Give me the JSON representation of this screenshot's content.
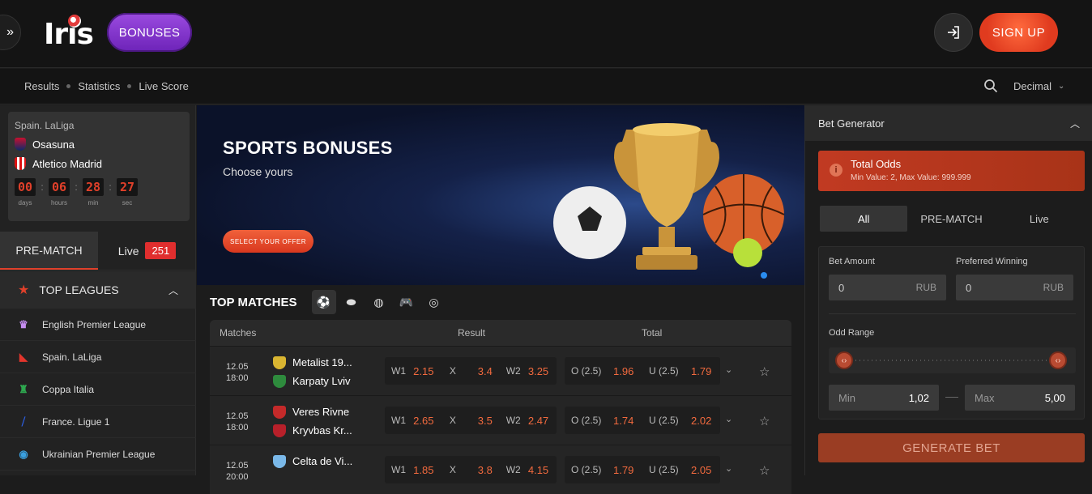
{
  "header": {
    "logo_text": "Iris",
    "bonuses_label": "BONUSES",
    "signup_label": "SIGN UP"
  },
  "subnav": {
    "links": [
      "Results",
      "Statistics",
      "Live Score"
    ],
    "odds_format": "Decimal"
  },
  "live_card": {
    "league": "Spain. LaLiga",
    "team1": "Osasuna",
    "team2": "Atletico Madrid",
    "countdown": [
      {
        "value": "00",
        "label": "days"
      },
      {
        "value": "06",
        "label": "hours"
      },
      {
        "value": "28",
        "label": "min"
      },
      {
        "value": "27",
        "label": "sec"
      }
    ]
  },
  "mode_tabs": {
    "prematch": "PRE-MATCH",
    "live": "Live",
    "live_count": "251"
  },
  "top_leagues": {
    "title": "TOP LEAGUES",
    "items": [
      "English Premier League",
      "Spain. LaLiga",
      "Coppa Italia",
      "France. Ligue 1",
      "Ukrainian Premier League"
    ]
  },
  "banner": {
    "title": "SPORTS BONUSES",
    "subtitle": "Choose yours",
    "button": "SELECT YOUR OFFER"
  },
  "top_matches": {
    "title": "TOP MATCHES",
    "columns": {
      "matches": "Matches",
      "result": "Result",
      "total": "Total"
    },
    "rows": [
      {
        "date": "12.05",
        "time": "18:00",
        "team1": "Metalist 19...",
        "team2": "Karpaty Lviv",
        "w1": "2.15",
        "x": "3.4",
        "w2": "3.25",
        "o_label": "O (2.5)",
        "o": "1.96",
        "u_label": "U (2.5)",
        "u": "1.79",
        "lbl_w1": "W1",
        "lbl_x": "X",
        "lbl_w2": "W2"
      },
      {
        "date": "12.05",
        "time": "18:00",
        "team1": "Veres Rivne",
        "team2": "Kryvbas Kr...",
        "w1": "2.65",
        "x": "3.5",
        "w2": "2.47",
        "o_label": "O (2.5)",
        "o": "1.74",
        "u_label": "U (2.5)",
        "u": "2.02",
        "lbl_w1": "W1",
        "lbl_x": "X",
        "lbl_w2": "W2"
      },
      {
        "date": "12.05",
        "time": "20:00",
        "team1": "Celta de Vi...",
        "team2": "",
        "w1": "1.85",
        "x": "3.8",
        "w2": "4.15",
        "o_label": "O (2.5)",
        "o": "1.79",
        "u_label": "U (2.5)",
        "u": "2.05",
        "lbl_w1": "W1",
        "lbl_x": "X",
        "lbl_w2": "W2"
      }
    ]
  },
  "bet_generator": {
    "title": "Bet Generator",
    "total_odds_title": "Total Odds",
    "total_odds_sub": "Min Value: 2, Max Value: 999.999",
    "tabs": [
      "All",
      "PRE-MATCH",
      "Live"
    ],
    "bet_amount_label": "Bet Amount",
    "bet_amount_value": "0",
    "bet_amount_unit": "RUB",
    "preferred_label": "Preferred Winning",
    "preferred_value": "0",
    "preferred_unit": "RUB",
    "odd_range_label": "Odd Range",
    "min_label": "Min",
    "min_value": "1,02",
    "max_label": "Max",
    "max_value": "5,00",
    "generate_label": "GENERATE BET"
  },
  "colors": {
    "accent": "#e0402a",
    "odds": "#f26a3e",
    "bonuses": "#7a30c8"
  }
}
